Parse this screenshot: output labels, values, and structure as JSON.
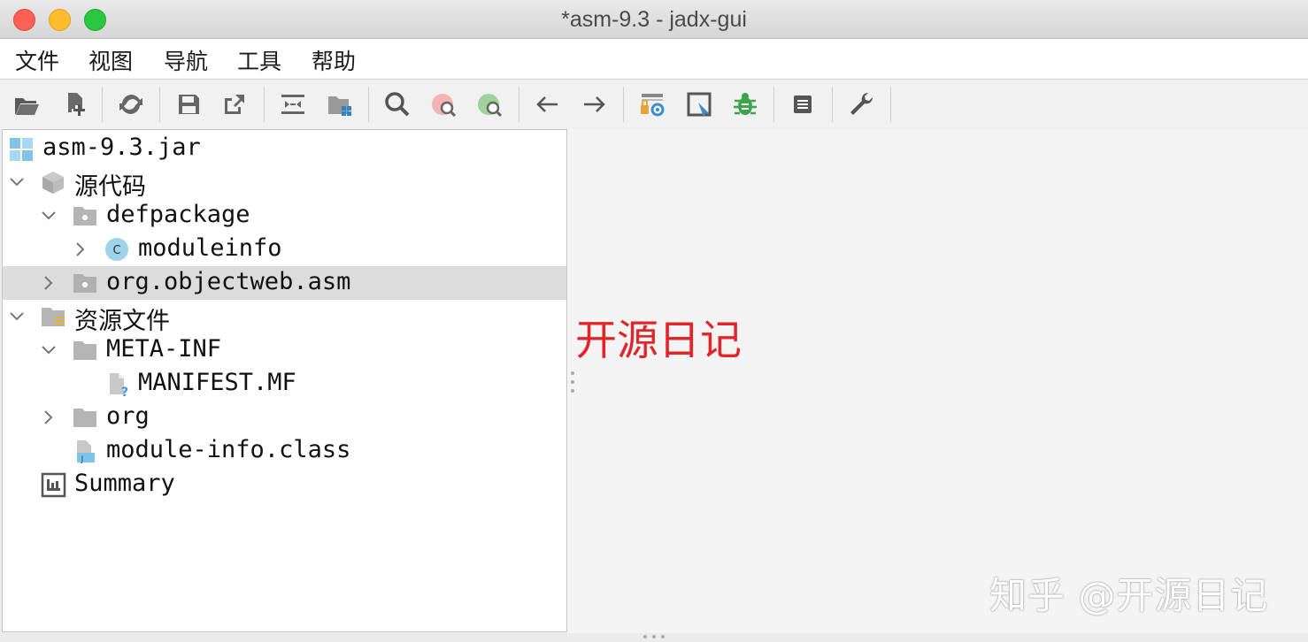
{
  "window": {
    "title": "*asm-9.3 - jadx-gui"
  },
  "menu": [
    "文件",
    "视图",
    "导航",
    "工具",
    "帮助"
  ],
  "toolbar_icons": [
    "open-folder-icon",
    "add-file-icon",
    "sync-icon",
    "save-icon",
    "export-icon",
    "flatten-icon",
    "package-icon",
    "search-icon",
    "class-search-icon",
    "usage-search-icon",
    "back-arrow-icon",
    "forward-arrow-icon",
    "deobfuscation-icon",
    "log-viewer-icon",
    "debug-icon",
    "preferences-list-icon",
    "settings-wrench-icon"
  ],
  "tree": [
    {
      "label": "asm-9.3.jar",
      "level": 0,
      "chevron": "none",
      "icon": "jar-icon"
    },
    {
      "label": "源代码",
      "level": 0,
      "chevron": "down",
      "icon": "source-package-icon"
    },
    {
      "label": "defpackage",
      "level": 1,
      "chevron": "down",
      "icon": "package-folder-icon"
    },
    {
      "label": "moduleinfo",
      "level": 2,
      "chevron": "right",
      "icon": "class-icon"
    },
    {
      "label": "org.objectweb.asm",
      "level": 1,
      "chevron": "right",
      "icon": "package-folder-icon",
      "selected": true
    },
    {
      "label": "资源文件",
      "level": 0,
      "chevron": "down",
      "icon": "resources-folder-icon"
    },
    {
      "label": "META-INF",
      "level": 1,
      "chevron": "down",
      "icon": "folder-icon"
    },
    {
      "label": "MANIFEST.MF",
      "level": 2,
      "chevron": "none",
      "icon": "unknown-file-icon"
    },
    {
      "label": "org",
      "level": 1,
      "chevron": "right",
      "icon": "folder-icon"
    },
    {
      "label": "module-info.class",
      "level": 1,
      "chevron": "none",
      "icon": "java-class-file-icon"
    },
    {
      "label": "Summary",
      "level": 0,
      "chevron": "none",
      "icon": "summary-icon"
    }
  ],
  "overlay_text": "开源日记",
  "watermark": "知乎 @开源日记",
  "colors": {
    "overlay": "#e0262a",
    "selected_row": "#dcdcdc"
  }
}
